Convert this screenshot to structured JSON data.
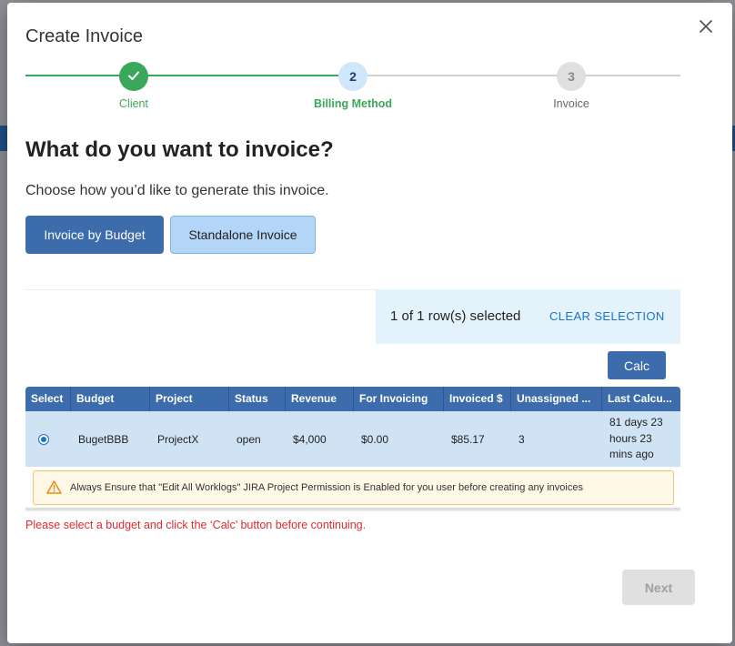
{
  "dialog": {
    "title": "Create Invoice"
  },
  "stepper": {
    "steps": [
      {
        "number": "",
        "label": "Client",
        "state": "complete"
      },
      {
        "number": "2",
        "label": "Billing Method",
        "state": "active"
      },
      {
        "number": "3",
        "label": "Invoice",
        "state": "pending"
      }
    ]
  },
  "content": {
    "question": "What do you want to invoice?",
    "subtext": "Choose how you’d like to generate this invoice.",
    "invoice_by_budget_label": "Invoice by Budget",
    "standalone_invoice_label": "Standalone Invoice"
  },
  "selection": {
    "text": "1 of 1 row(s) selected",
    "clear_label": "CLEAR SELECTION"
  },
  "calc_label": "Calc",
  "table": {
    "columns": [
      "Select",
      "Budget",
      "Project",
      "Status",
      "Revenue",
      "For Invoicing",
      "Invoiced $",
      "Unassigned ...",
      "Last Calcu..."
    ],
    "rows": [
      {
        "selected": true,
        "budget": "BugetBBB",
        "project": "ProjectX",
        "status": "open",
        "revenue": "$4,000",
        "for_invoicing": "$0.00",
        "invoiced": "$85.17",
        "unassigned": "3",
        "last_calculated": "81 days 23 hours 23 mins ago"
      }
    ]
  },
  "warning": {
    "text": "Always Ensure that \"Edit All Worklogs\" JIRA Project Permission is Enabled for you user before creating any invoices"
  },
  "error": {
    "text": "Please select a budget and click the ‘Calc’ button before continuing."
  },
  "footer": {
    "next_label": "Next"
  },
  "colors": {
    "primary": "#3c6cac",
    "success": "#3aa85a",
    "active_step_bg": "#cfe6fb",
    "error": "#e0282e",
    "warning_border": "#f0c46a"
  }
}
